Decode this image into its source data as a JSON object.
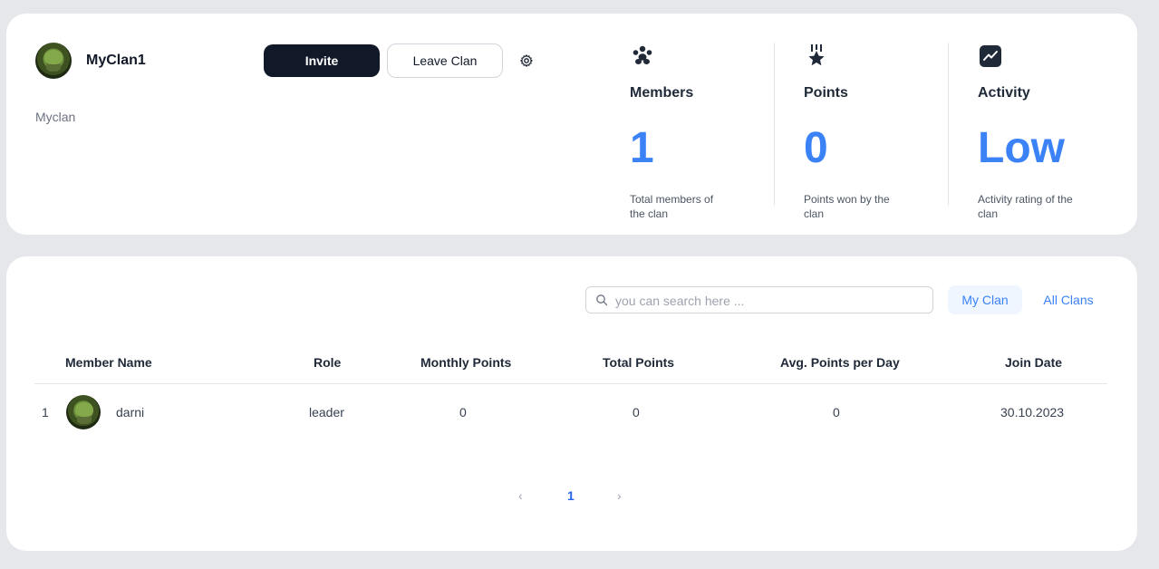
{
  "clan": {
    "name": "MyClan1",
    "description": "Myclan",
    "invite_label": "Invite",
    "leave_label": "Leave Clan"
  },
  "stats": [
    {
      "title": "Members",
      "value": "1",
      "description": "Total members of the clan",
      "icon": "members-icon"
    },
    {
      "title": "Points",
      "value": "0",
      "description": "Points won by the clan",
      "icon": "points-star-icon"
    },
    {
      "title": "Activity",
      "value": "Low",
      "description": "Activity rating of the clan",
      "icon": "activity-chart-icon"
    }
  ],
  "search": {
    "placeholder": "you can search here ..."
  },
  "tabs": {
    "my_clan": "My Clan",
    "all_clans": "All Clans"
  },
  "table": {
    "headers": [
      "Member Name",
      "Role",
      "Monthly Points",
      "Total Points",
      "Avg. Points per Day",
      "Join Date"
    ],
    "rows": [
      {
        "index": "1",
        "name": "darni",
        "role": "leader",
        "monthly": "0",
        "total": "0",
        "avg": "0",
        "join_date": "30.10.2023"
      }
    ]
  },
  "pagination": {
    "current": "1",
    "prev": "‹",
    "next": "›"
  },
  "colors": {
    "accent": "#3b82f6",
    "dark": "#111827",
    "background": "#e5e7eb"
  }
}
